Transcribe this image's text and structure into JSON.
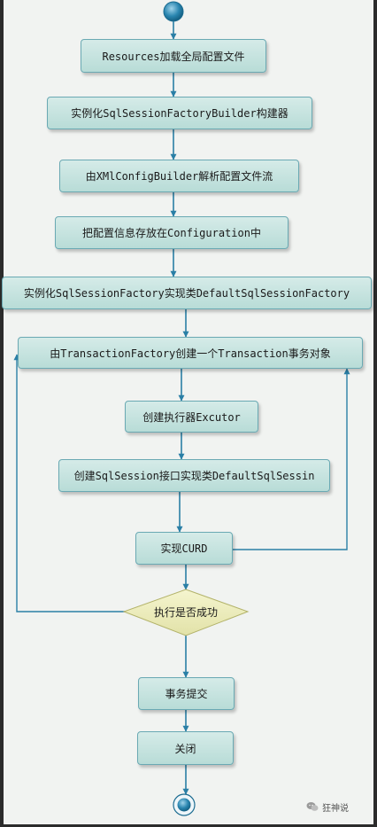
{
  "nodes": {
    "n1": "Resources加载全局配置文件",
    "n2": "实例化SqlSessionFactoryBuilder构建器",
    "n3": "由XMlConfigBuilder解析配置文件流",
    "n4": "把配置信息存放在Configuration中",
    "n5": "实例化SqlSessionFactory实现类DefaultSqlSessionFactory",
    "n6": "由TransactionFactory创建一个Transaction事务对象",
    "n7": "创建执行器Excutor",
    "n8": "创建SqlSession接口实现类DefaultSqlSessin",
    "n9": "实现CURD",
    "decision": "执行是否成功",
    "n10": "事务提交",
    "n11": "关闭"
  },
  "watermark": "狂神说",
  "colors": {
    "node_fill_top": "#d5ebe8",
    "node_fill_bottom": "#b8dcd7",
    "node_border": "#6aa9b3",
    "arrow": "#2a7fa6",
    "decision_fill": "#eeeebb",
    "background": "#f1f3f1"
  }
}
